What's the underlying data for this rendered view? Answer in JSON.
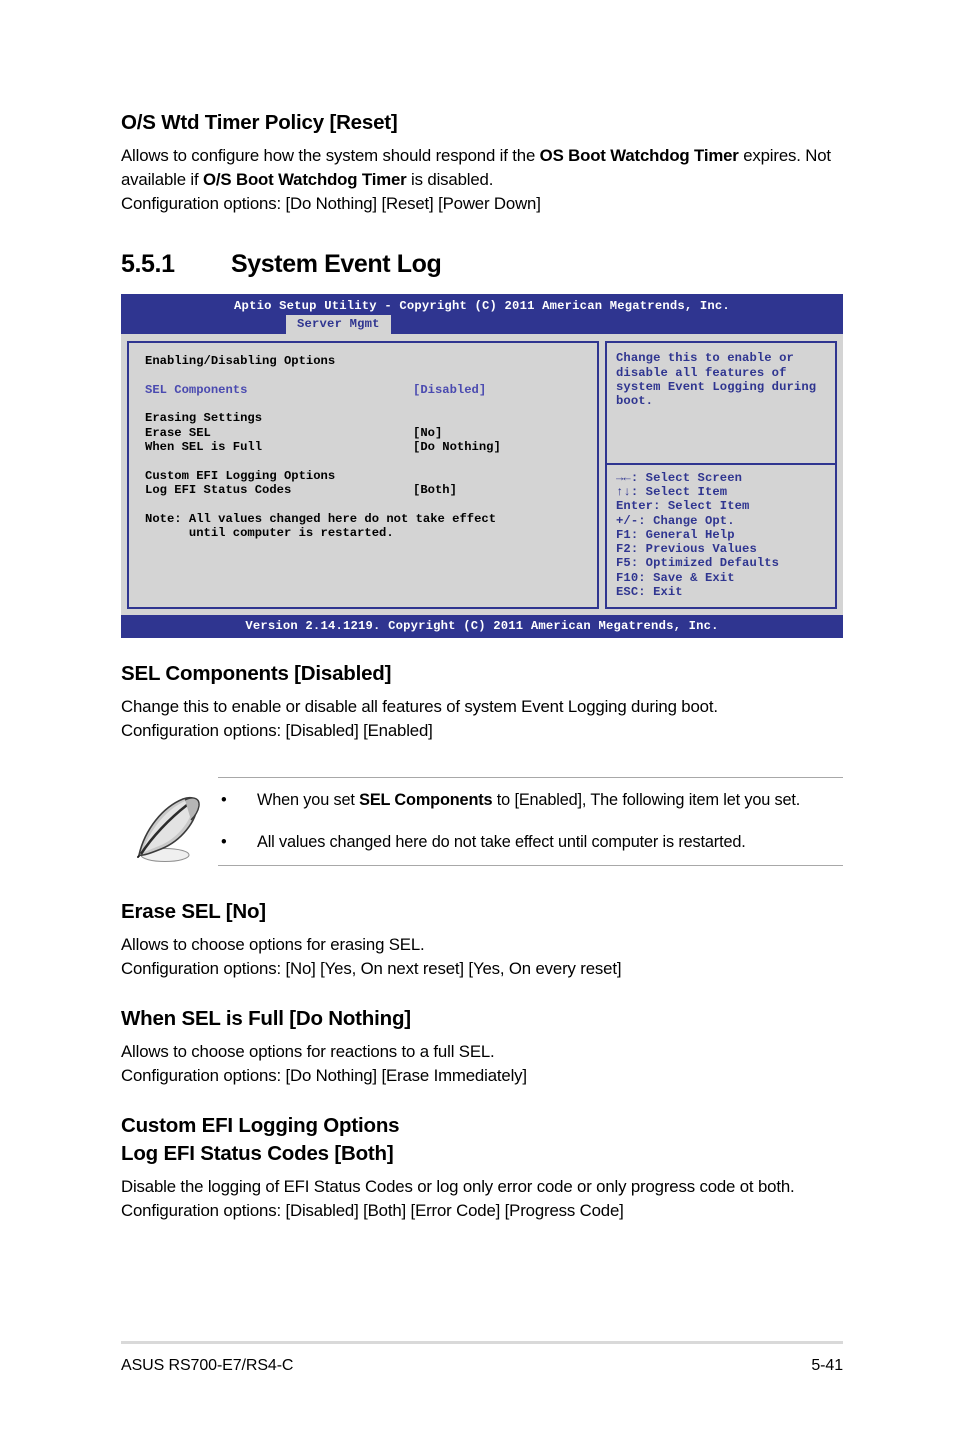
{
  "sections": [
    {
      "heading": "O/S Wtd Timer Policy [Reset]",
      "paragraphs": [
        "Allows to configure how the system should respond if the OS Boot Watchdog Timer expires. Not available if O/S Boot Watchdog Timer is disabled.",
        "Configuration options: [Do Nothing] [Reset] [Power Down]"
      ]
    }
  ],
  "numbered_section": {
    "number": "5.5.1",
    "title": "System Event Log"
  },
  "bios": {
    "title": "Aptio Setup Utility - Copyright (C) 2011 American Megatrends, Inc.",
    "active_tab": "Server Mgmt",
    "left_panel": {
      "group1_header": "Enabling/Disabling Options",
      "group1_items": [
        {
          "label": "SEL Components",
          "value": "[Disabled]"
        }
      ],
      "group2_header": "Erasing Settings",
      "group2_items": [
        {
          "label": "Erase SEL",
          "value": "[No]"
        },
        {
          "label": "When SEL is Full",
          "value": "[Do Nothing]"
        }
      ],
      "group3_header": "Custom EFI Logging Options",
      "group3_items": [
        {
          "label": "Log EFI Status Codes",
          "value": "[Both]"
        }
      ],
      "note_line1": "Note: All values changed here do not take effect",
      "note_line2": "      until computer is restarted."
    },
    "help_text": "Change this to enable or disable all features of system Event Logging during boot.",
    "keys": [
      "→←: Select Screen",
      "↑↓:  Select Item",
      "Enter: Select Item",
      "+/-: Change Opt.",
      "F1: General Help",
      "F2: Previous Values",
      "F5: Optimized Defaults",
      "F10: Save & Exit",
      "ESC: Exit"
    ],
    "footer": "Version 2.14.1219. Copyright (C) 2011 American Megatrends, Inc.",
    "colors": {
      "bar": "#2f3590",
      "panel": "#d4d4d4",
      "text_blue": "#2f3590",
      "item_blue": "#4a4ab0"
    }
  },
  "sel_components": {
    "heading": "SEL Components [Disabled]",
    "paragraphs": [
      "Change this to enable or disable all features of system Event Logging during boot.",
      "Configuration options: [Disabled] [Enabled]"
    ]
  },
  "note_box": {
    "icon": "quill-pen-icon",
    "bullet": "•",
    "items": [
      "When you set SEL Components to [Enabled], The following item let you set.",
      "All values changed here do not take effect until computer is restarted."
    ]
  },
  "erase_sel": {
    "heading": "Erase SEL [No]",
    "paragraphs": [
      "Allows to choose options for erasing SEL.",
      "Configuration options: [No] [Yes, On next reset] [Yes, On every reset]"
    ]
  },
  "when_sel_full": {
    "heading": "When SEL is Full [Do Nothing]",
    "paragraphs": [
      "Allows to choose options for reactions to a full SEL.",
      "Configuration options: [Do Nothing] [Erase Immediately]"
    ]
  },
  "custom_efi": {
    "heading": "Custom EFI Logging Options",
    "subheading": "Log EFI Status Codes [Both]",
    "paragraphs": [
      "Disable the logging of EFI Status Codes or log only error code or only progress code ot both. Configuration options: [Disabled] [Both] [Error Code] [Progress Code]"
    ]
  },
  "footer": {
    "product": "ASUS RS700-E7/RS4-C",
    "page_number": "5-41"
  }
}
